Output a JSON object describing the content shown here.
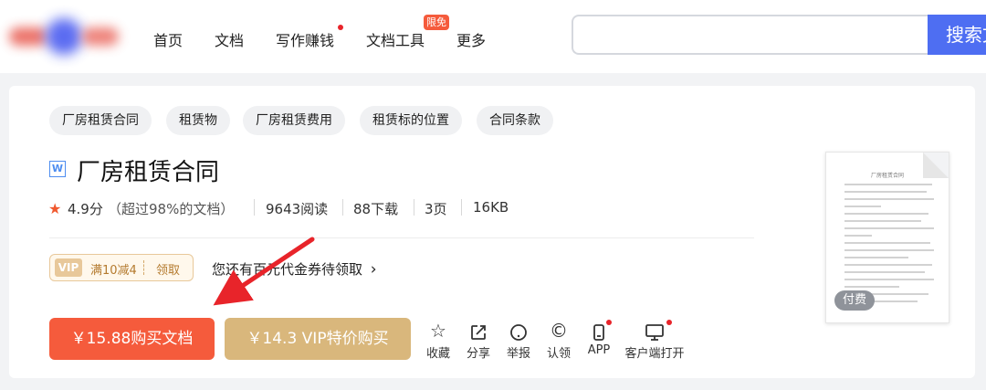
{
  "header": {
    "logo_icon": "blurred-logo",
    "nav": [
      {
        "label": "首页"
      },
      {
        "label": "文档"
      },
      {
        "label": "写作赚钱",
        "has_dot": true
      },
      {
        "label": "文档工具",
        "badge": "限免"
      },
      {
        "label": "更多"
      }
    ],
    "search": {
      "value": "",
      "button_label": "搜索文"
    }
  },
  "tags": [
    "厂房租赁合同",
    "租赁物",
    "厂房租赁费用",
    "租赁标的位置",
    "合同条款"
  ],
  "doc": {
    "type_icon": "W",
    "title": "厂房租赁合同",
    "rating": "4.9分",
    "rating_note": "（超过98%的文档）",
    "reads": "9643阅读",
    "downloads": "88下载",
    "pages": "3页",
    "size": "16KB"
  },
  "coupon": {
    "vip_label": "VIP",
    "amount": "满10减4",
    "get_label": "领取",
    "notice": "您还有百元代金券待领取",
    "chevron": "›"
  },
  "buttons": {
    "buy": "￥15.88购买文档",
    "vip_buy": "￥14.3 VIP特价购买"
  },
  "actions": [
    {
      "label": "收藏",
      "icon": "star-outline-icon"
    },
    {
      "label": "分享",
      "icon": "share-icon"
    },
    {
      "label": "举报",
      "icon": "report-icon"
    },
    {
      "label": "认领",
      "icon": "copyright-icon"
    },
    {
      "label": "APP",
      "icon": "phone-icon",
      "has_dot": true
    },
    {
      "label": "客户端打开",
      "icon": "monitor-icon",
      "has_dot": true
    }
  ],
  "preview": {
    "page_title": "厂房租赁合同",
    "paid_label": "付费"
  },
  "colors": {
    "primary_orange": "#f55b3c",
    "vip_gold": "#d9b77c",
    "search_blue": "#4e6ef2",
    "arrow_red": "#e8242a"
  }
}
